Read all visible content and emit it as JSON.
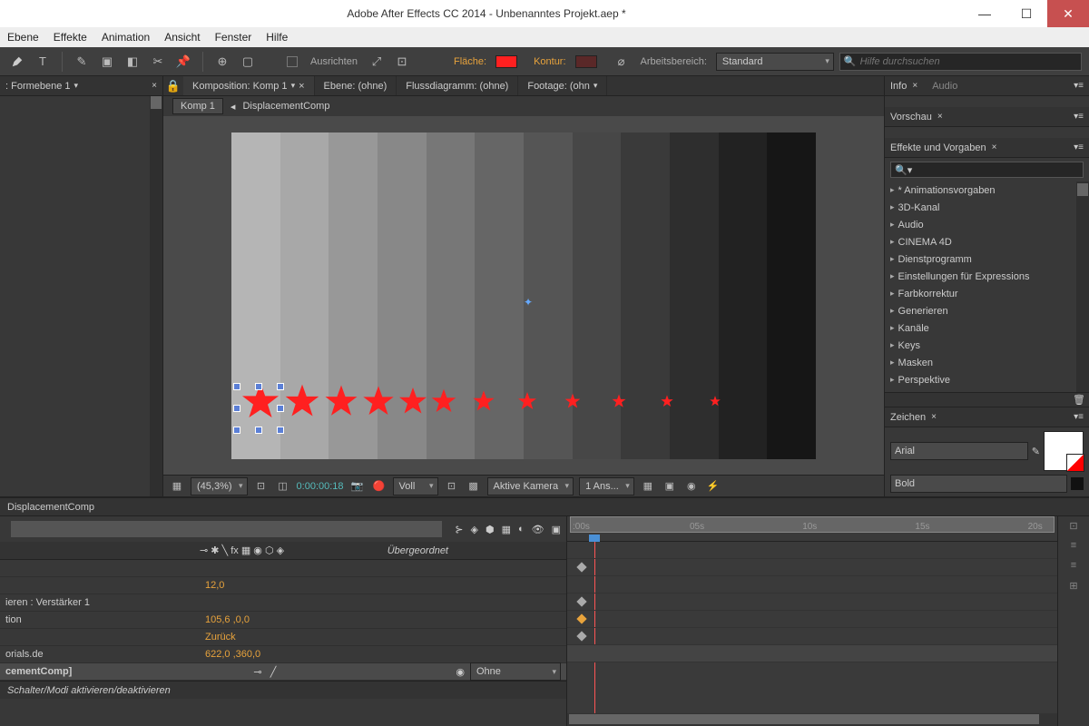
{
  "title": "Adobe After Effects CC 2014 - Unbenanntes Projekt.aep *",
  "menu": [
    "Ebene",
    "Effekte",
    "Animation",
    "Ansicht",
    "Fenster",
    "Hilfe"
  ],
  "toolbar": {
    "align": "Ausrichten",
    "fill": "Fläche:",
    "fillColor": "#ff2020",
    "stroke": "Kontur:",
    "strokeColor": "#7a3030",
    "workspace_label": "Arbeitsbereich:",
    "workspace_value": "Standard",
    "search_placeholder": "Hilfe durchsuchen"
  },
  "left": {
    "tab": ": Formebene 1"
  },
  "comp": {
    "tabs": [
      {
        "label": "Komposition: Komp 1",
        "active": true
      },
      {
        "label": "Ebene: (ohne)"
      },
      {
        "label": "Flussdiagramm: (ohne)"
      },
      {
        "label": "Footage: (ohn"
      }
    ],
    "breadcrumb": [
      "Komp 1",
      "DisplacementComp"
    ],
    "zoom": "(45,3%)",
    "time": "0:00:00:18",
    "res": "Voll",
    "camera": "Aktive Kamera",
    "views": "1 Ans..."
  },
  "right": {
    "info": "Info",
    "audio": "Audio",
    "preview": "Vorschau",
    "effects": "Effekte und Vorgaben",
    "effect_list": [
      "* Animationsvorgaben",
      "3D-Kanal",
      "Audio",
      "CINEMA 4D",
      "Dienstprogramm",
      "Einstellungen für Expressions",
      "Farbkorrektur",
      "Generieren",
      "Kanäle",
      "Keys",
      "Masken",
      "Perspektive"
    ],
    "char": "Zeichen",
    "font": "Arial",
    "weight": "Bold"
  },
  "timeline": {
    "tab": "DisplacementComp",
    "parent_col": "Übergeordnet",
    "ticks": [
      ":00s",
      "05s",
      "10s",
      "15s",
      "20s"
    ],
    "rows": [
      {
        "label": "",
        "value": ""
      },
      {
        "label": "",
        "value": "12,0"
      },
      {
        "label": "ieren : Verstärker 1",
        "value": ""
      },
      {
        "label": "tion",
        "value": "105,6 ,0,0"
      },
      {
        "label": "",
        "value": "Zurück"
      },
      {
        "label": "orials.de",
        "value": "622,0 ,360,0"
      },
      {
        "label": "cementComp]",
        "value": ""
      }
    ],
    "parent_none": "Ohne",
    "footer": "Schalter/Modi aktivieren/deaktivieren"
  }
}
